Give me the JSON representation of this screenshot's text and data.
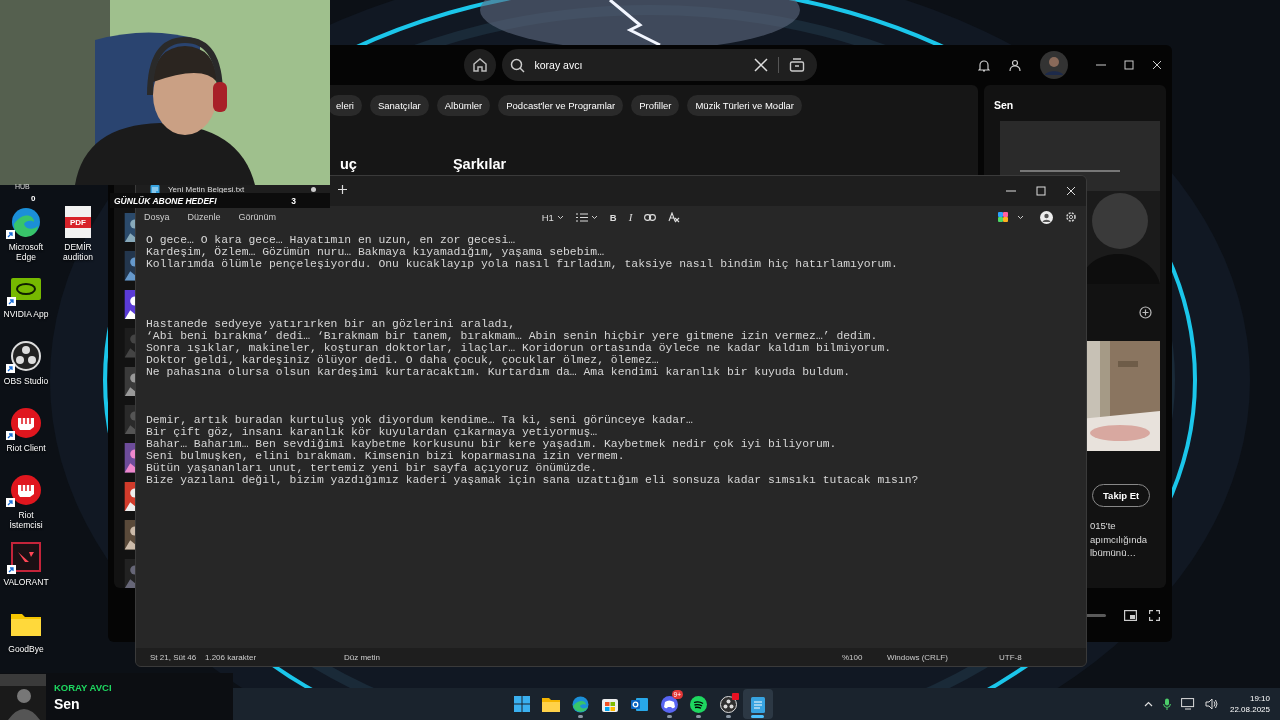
{
  "stream_overlay": {
    "hub_label": "HUB",
    "hub_count": "0",
    "goal_label": "GÜNLÜK ABONE HEDEFI",
    "goal_count": "3"
  },
  "desktop_icons": {
    "column_1": [
      {
        "label": "Microsoft Edge",
        "kind": "edge",
        "shortcut": true
      },
      {
        "label": "NVIDIA App",
        "kind": "nvidia",
        "shortcut": true
      },
      {
        "label": "OBS Studio",
        "kind": "obs",
        "shortcut": true
      },
      {
        "label": "Riot Client",
        "kind": "riot",
        "shortcut": true
      },
      {
        "label": "Riot İstemcisi",
        "kind": "riot",
        "shortcut": true
      },
      {
        "label": "VALORANT",
        "kind": "valorant",
        "shortcut": true
      },
      {
        "label": "GoodBye",
        "kind": "folder",
        "shortcut": false
      }
    ],
    "column_2": [
      {
        "label": "DEMİR audition",
        "kind": "pdf",
        "icon_text": "PDF",
        "shortcut": false
      }
    ]
  },
  "spotify": {
    "search": {
      "value": "koray avcı"
    },
    "filter_chips": [
      {
        "label": "eleri",
        "selected": false
      },
      {
        "label": "Sanatçılar",
        "selected": false
      },
      {
        "label": "Albümler",
        "selected": false
      },
      {
        "label": "Podcast'ler ve Programlar",
        "selected": false
      },
      {
        "label": "Profiller",
        "selected": false
      },
      {
        "label": "Müzik Türleri ve Modlar",
        "selected": false
      }
    ],
    "section_titles": [
      "uç",
      "Şarkılar"
    ],
    "right_panel": {
      "title": "Sen",
      "follow_button": "Takip Et",
      "bio_lines": [
        "015'te",
        "apımcılığında",
        "lbümünü…"
      ]
    }
  },
  "notepad": {
    "tab_title": "Yeni Metin Belgesi.txt",
    "unsaved": true,
    "menu": [
      "Dosya",
      "Düzenle",
      "Görünüm"
    ],
    "toolbar": {
      "heading": "H1",
      "bold": "B",
      "italic": "I"
    },
    "paragraphs": [
      [
        "O gece… O kara gece… Hayatımın en uzun, en zor gecesi…",
        "Kardeşim, Özlem… Gözümün nuru… Bakmaya kıyamadığım, yaşama sebebim…",
        "Kollarımda ölümle pençeleşiyordu. Onu kucaklayıp yola nasıl fırladım, taksiye nasıl bindim hiç hatırlamıyorum."
      ],
      [
        "Hastanede sedyeye yatırırken bir an gözlerini araladı,",
        "‘Abi beni bırakma’ dedi… ‘Bırakmam bir tanem, bırakmam… Abin senin hiçbir yere gitmene izin vermez…’ dedim.",
        "Sonra ışıklar, makineler, koşturan doktorlar, ilaçlar… Koridorun ortasında öylece ne kadar kaldım bilmiyorum.",
        "Doktor geldi, kardeşiniz ölüyor dedi. O daha çocuk, çocuklar ölmez, ölemez…",
        "Ne pahasına olursa olsun kardeşimi kurtaracaktım. Kurtardım da… Ama kendimi karanlık bir kuyuda buldum."
      ],
      [
        "Demir, artık buradan kurtuluş yok diyordum kendime… Ta ki, seni görünceye kadar…",
        "Bir çift göz, insanı karanlık kör kuyulardan çıkarmaya yetiyormuş…",
        "Bahar… Baharım… Ben sevdiğimi kaybetme korkusunu bir kere yaşadım. Kaybetmek nedir çok iyi biliyorum.",
        "Seni bulmuşken, elini bırakmam. Kimsenin bizi koparmasına izin vermem.",
        "Bütün yaşananları unut, tertemiz yeni bir sayfa açıyoruz önümüzde.",
        "Bize yazılanı değil, bizim yazdığımız kaderi yaşamak için sana uzattığım eli sonsuza kadar sımsıkı tutacak mısın?"
      ]
    ],
    "status_bar": {
      "position": "St 21, Süt 46",
      "characters": "1.206 karakter",
      "format": "Düz metin",
      "zoom": "%100",
      "line_ending": "Windows (CRLF)",
      "encoding": "UTF-8"
    }
  },
  "now_playing": {
    "artist": "KORAY AVCI",
    "title": "Sen"
  },
  "taskbar": {
    "apps": [
      {
        "kind": "start",
        "running": false,
        "selected": false,
        "alert": false
      },
      {
        "kind": "explorer",
        "running": false,
        "selected": false,
        "alert": false
      },
      {
        "kind": "edge",
        "running": true,
        "selected": false,
        "alert": false
      },
      {
        "kind": "store",
        "running": false,
        "selected": false,
        "alert": false
      },
      {
        "kind": "outlook",
        "running": false,
        "selected": false,
        "alert": false
      },
      {
        "kind": "discord",
        "running": true,
        "selected": false,
        "alert": false,
        "badge": "9+"
      },
      {
        "kind": "spotify",
        "running": true,
        "selected": false,
        "alert": false
      },
      {
        "kind": "obs",
        "running": true,
        "selected": false,
        "alert": true
      },
      {
        "kind": "notepad",
        "running": true,
        "selected": true,
        "alert": false
      }
    ],
    "time": "19:10",
    "date": "22.08.2025"
  }
}
